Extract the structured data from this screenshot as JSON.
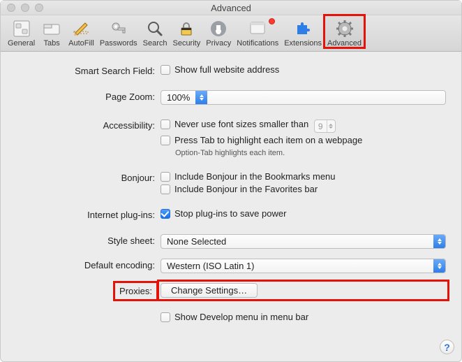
{
  "window": {
    "title": "Advanced"
  },
  "toolbar": {
    "items": [
      {
        "label": "General",
        "icon": "switches-icon"
      },
      {
        "label": "Tabs",
        "icon": "tab-icon"
      },
      {
        "label": "AutoFill",
        "icon": "pencil-icon"
      },
      {
        "label": "Passwords",
        "icon": "key-icon"
      },
      {
        "label": "Search",
        "icon": "magnifier-icon"
      },
      {
        "label": "Security",
        "icon": "lock-icon"
      },
      {
        "label": "Privacy",
        "icon": "hand-icon"
      },
      {
        "label": "Notifications",
        "icon": "bell-icon",
        "badge": true
      },
      {
        "label": "Extensions",
        "icon": "puzzle-icon"
      },
      {
        "label": "Advanced",
        "icon": "gear-icon",
        "selected": true
      }
    ]
  },
  "rows": {
    "smart_search": {
      "label": "Smart Search Field:",
      "opt1": "Show full website address"
    },
    "page_zoom": {
      "label": "Page Zoom:",
      "value": "100%"
    },
    "accessibility": {
      "label": "Accessibility:",
      "opt1": "Never use font sizes smaller than",
      "min_font": "9",
      "opt2": "Press Tab to highlight each item on a webpage",
      "hint": "Option-Tab highlights each item."
    },
    "bonjour": {
      "label": "Bonjour:",
      "opt1": "Include Bonjour in the Bookmarks menu",
      "opt2": "Include Bonjour in the Favorites bar"
    },
    "plugins": {
      "label": "Internet plug-ins:",
      "opt1": "Stop plug-ins to save power"
    },
    "style_sheet": {
      "label": "Style sheet:",
      "value": "None Selected"
    },
    "encoding": {
      "label": "Default encoding:",
      "value": "Western (ISO Latin 1)"
    },
    "proxies": {
      "label": "Proxies:",
      "button": "Change Settings…"
    },
    "develop": {
      "opt1": "Show Develop menu in menu bar"
    }
  },
  "help": "?"
}
